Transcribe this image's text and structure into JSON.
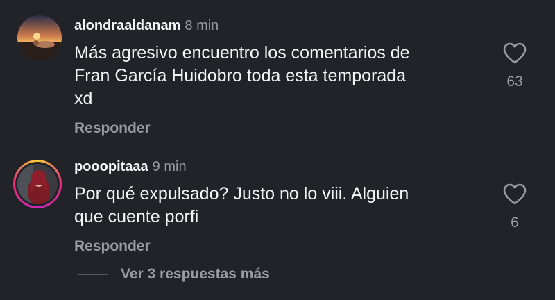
{
  "comments": [
    {
      "username": "alondraaldanam",
      "time": "8 min",
      "text_lines": [
        "Más agresivo encuentro los comentarios de",
        "Fran García Huidobro toda esta temporada",
        "xd"
      ],
      "reply_label": "Responder",
      "likes": "63",
      "avatar_icon": "sunset-photo-avatar"
    },
    {
      "username": "pooopitaaa",
      "time": "9 min",
      "text_lines": [
        "Por qué expulsado? Justo no lo viii. Alguien",
        "que cuente porfi"
      ],
      "reply_label": "Responder",
      "likes": "6",
      "avatar_icon": "red-hair-portrait-avatar",
      "has_story_ring": true
    }
  ],
  "more_replies_label": "Ver 3 respuestas más",
  "colors": {
    "background": "#212329",
    "text": "#f5f5f5",
    "secondary": "#9a9ba0"
  }
}
